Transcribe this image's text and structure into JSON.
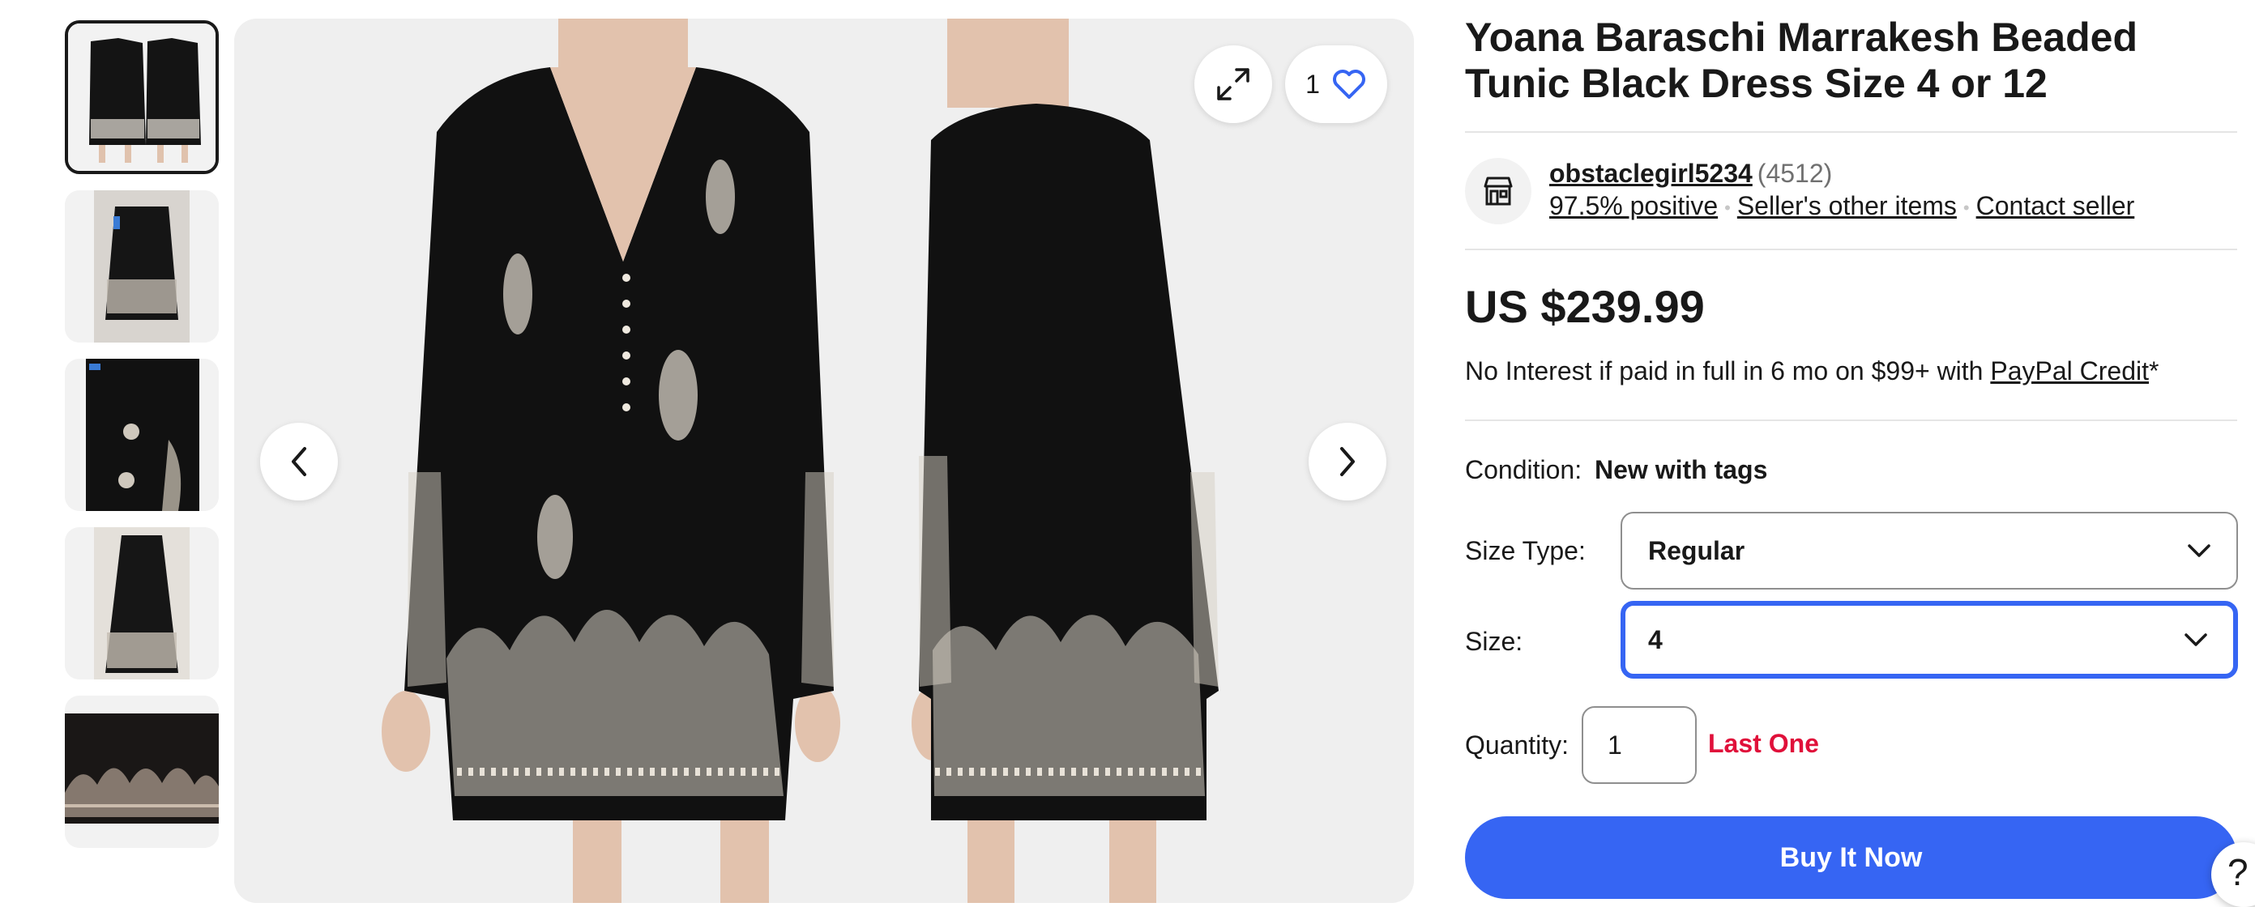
{
  "product": {
    "title": "Yoana Baraschi Marrakesh Beaded Tunic Black Dress Size 4 or 12",
    "price": "US $239.99"
  },
  "gallery": {
    "watch_count": "1",
    "thumbnail_count": 5,
    "active_thumbnail": 1
  },
  "seller": {
    "name": "obstaclegirl5234",
    "feedback_count": "(4512)",
    "positive": "97.5% positive",
    "other_items": "Seller's other items",
    "contact": "Contact seller"
  },
  "financing": {
    "text_before": "No Interest if paid in full in 6 mo on $99+ with ",
    "link": "PayPal Credit",
    "text_after": "*"
  },
  "condition": {
    "label": "Condition:",
    "value": "New with tags"
  },
  "size_type": {
    "label": "Size Type:",
    "value": "Regular"
  },
  "size": {
    "label": "Size:",
    "value": "4"
  },
  "quantity": {
    "label": "Quantity:",
    "value": "1",
    "availability": "Last One"
  },
  "actions": {
    "buy_now": "Buy It Now",
    "help": "?"
  },
  "colors": {
    "accent": "#3665f3",
    "warning": "#e0103a",
    "text": "#191919",
    "muted": "#707070"
  },
  "icons": [
    "store-icon",
    "expand-icon",
    "heart-icon",
    "chevron-left-icon",
    "chevron-right-icon",
    "chevron-down-icon"
  ]
}
